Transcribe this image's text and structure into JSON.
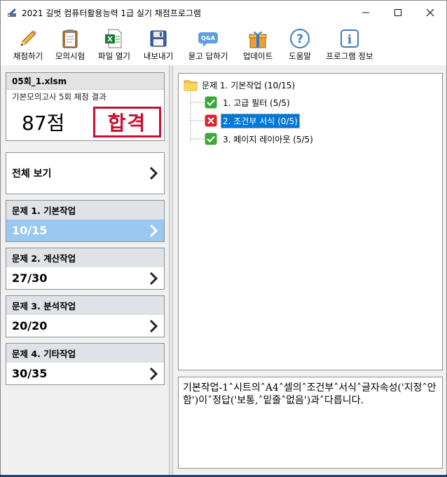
{
  "window": {
    "title": "2021 길벗 컴퓨터활용능력 1급 실기 채점프로그램"
  },
  "toolbar": {
    "items": [
      {
        "label": "채점하기",
        "icon": "pencil-icon"
      },
      {
        "label": "모의시험",
        "icon": "clipboard-icon"
      },
      {
        "label": "파일 열기",
        "icon": "excel-file-icon"
      },
      {
        "label": "내보내기",
        "icon": "floppy-disk-icon"
      },
      {
        "label": "묻고 답하기",
        "icon": "qna-bubble-icon"
      },
      {
        "label": "업데이트",
        "icon": "gift-box-icon"
      },
      {
        "label": "도움말",
        "icon": "help-icon"
      },
      {
        "label": "프로그램 정보",
        "icon": "info-icon"
      }
    ]
  },
  "result": {
    "file_name": "05회_1.xlsm",
    "exam_name": "기본모의고사 5회 채점 결과",
    "score": "87점",
    "stamp": "합격"
  },
  "overview": {
    "label": "전체 보기"
  },
  "problems": [
    {
      "title": "문제 1. 기본작업",
      "score": "10/15",
      "active": true
    },
    {
      "title": "문제 2. 계산작업",
      "score": "27/30",
      "active": false
    },
    {
      "title": "문제 3. 분석작업",
      "score": "20/20",
      "active": false
    },
    {
      "title": "문제 4. 기타작업",
      "score": "30/35",
      "active": false
    }
  ],
  "tree": {
    "root": "문제 1. 기본작업 (10/15)",
    "items": [
      {
        "label": "1. 고급 필터 (5/5)",
        "status": "pass"
      },
      {
        "label": "2. 조건부 서식 (0/5)",
        "status": "fail",
        "selected": true
      },
      {
        "label": "3. 페이지 레이아웃 (5/5)",
        "status": "pass"
      }
    ]
  },
  "description": {
    "text": "기본작업-1˄시트의˄A4˄셀의˄조건부˄서식˄글자속성('지정˄안함')이˄정답('보통,˄밑줄˄없음')과˄다릅니다."
  },
  "colors": {
    "active_row": "#99c9f0",
    "selection": "#0078d7",
    "stamp": "#c8102e",
    "pass": "#3aaa35",
    "fail": "#d9232d"
  }
}
